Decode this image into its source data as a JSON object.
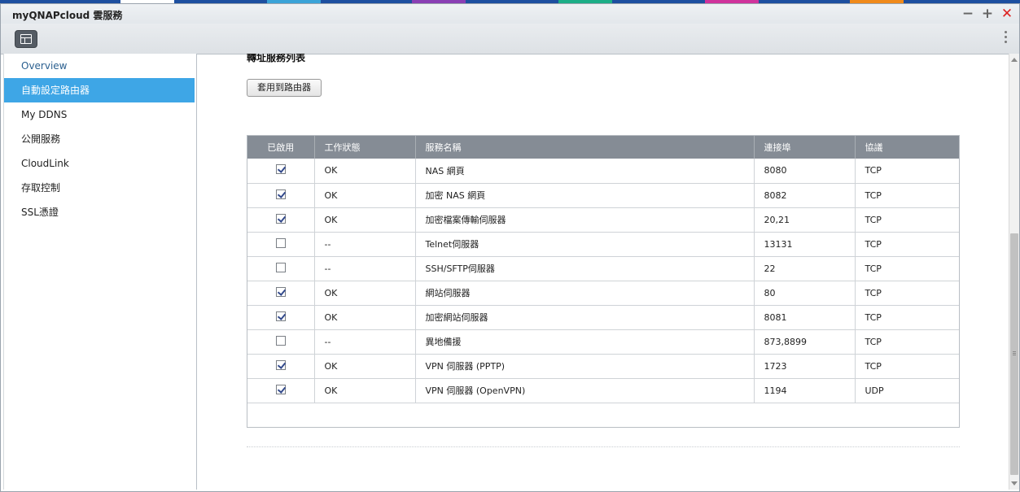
{
  "desktop": {
    "app_colors": [
      "#ffffff",
      "#3aa3d8",
      "#8a3fb4",
      "#1cae87",
      "#d0339c",
      "#f08a1c"
    ]
  },
  "window": {
    "title": "myQNAPcloud 雲服務",
    "minimize_label": "−",
    "maximize_label": "+",
    "close_label": "✕"
  },
  "sidebar": {
    "items": [
      {
        "label": "Overview"
      },
      {
        "label": "自動設定路由器"
      },
      {
        "label": "My DDNS"
      },
      {
        "label": "公開服務"
      },
      {
        "label": "CloudLink"
      },
      {
        "label": "存取控制"
      },
      {
        "label": "SSL憑證"
      }
    ]
  },
  "main": {
    "section_title": "轉址服務列表",
    "apply_button": "套用到路由器",
    "table": {
      "headers": [
        "已啟用",
        "工作狀態",
        "服務名稱",
        "連接埠",
        "協議"
      ],
      "rows": [
        {
          "enabled": true,
          "status": "OK",
          "service": "NAS 網頁",
          "port": "8080",
          "protocol": "TCP"
        },
        {
          "enabled": true,
          "status": "OK",
          "service": "加密 NAS 網頁",
          "port": "8082",
          "protocol": "TCP"
        },
        {
          "enabled": true,
          "status": "OK",
          "service": "加密檔案傳輸伺服器",
          "port": "20,21",
          "protocol": "TCP"
        },
        {
          "enabled": false,
          "status": "--",
          "service": "Telnet伺服器",
          "port": "13131",
          "protocol": "TCP"
        },
        {
          "enabled": false,
          "status": "--",
          "service": "SSH/SFTP伺服器",
          "port": "22",
          "protocol": "TCP"
        },
        {
          "enabled": true,
          "status": "OK",
          "service": "網站伺服器",
          "port": "80",
          "protocol": "TCP"
        },
        {
          "enabled": true,
          "status": "OK",
          "service": "加密網站伺服器",
          "port": "8081",
          "protocol": "TCP"
        },
        {
          "enabled": false,
          "status": "--",
          "service": "異地備援",
          "port": "873,8899",
          "protocol": "TCP"
        },
        {
          "enabled": true,
          "status": "OK",
          "service": "VPN 伺服器 (PPTP)",
          "port": "1723",
          "protocol": "TCP"
        },
        {
          "enabled": true,
          "status": "OK",
          "service": "VPN 伺服器 (OpenVPN)",
          "port": "1194",
          "protocol": "UDP"
        }
      ]
    }
  }
}
